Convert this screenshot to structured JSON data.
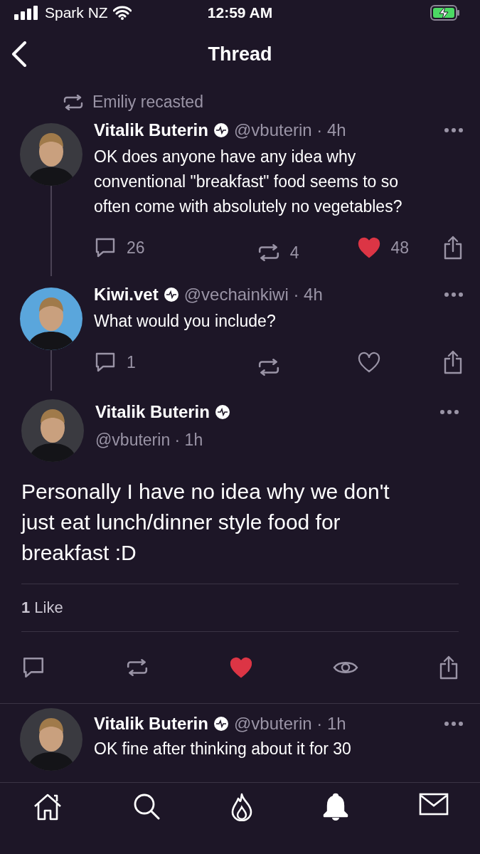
{
  "status_bar": {
    "carrier": "Spark NZ",
    "time": "12:59 AM",
    "charging": true
  },
  "header": {
    "title": "Thread"
  },
  "recast": {
    "text": "Emiliy recasted"
  },
  "thread": [
    {
      "name": "Vitalik Buterin",
      "meta": "@vbuterin · 4h",
      "avatar": {
        "kind": "picture",
        "color": "#3a3a40"
      },
      "text": "OK does anyone have any idea why conventional \"breakfast\" food seems to so often come with absolutely no vegetables?",
      "actions": [
        {
          "kind": "reply",
          "count": "26",
          "selected": false
        },
        {
          "kind": "recast",
          "count": "4",
          "selected": false
        },
        {
          "kind": "like",
          "count": "48",
          "selected": true
        },
        {
          "kind": "share",
          "selected": false
        }
      ]
    },
    {
      "name": "Kiwi.vet",
      "meta": "@vechainkiwi · 4h",
      "avatar": {
        "kind": "picture",
        "color": "#5aa6dc"
      },
      "text": "What would you include?",
      "actions": [
        {
          "kind": "reply",
          "count": "1",
          "selected": false
        },
        {
          "kind": "recast",
          "selected": false
        },
        {
          "kind": "like",
          "selected": false
        },
        {
          "kind": "share",
          "selected": false
        }
      ]
    }
  ],
  "focused": {
    "name": "Vitalik Buterin",
    "meta": "@vbuterin · 1h",
    "avatar": {
      "kind": "picture",
      "color": "#3a3a40"
    },
    "text": "Personally I have no idea why we don't just eat lunch/dinner style food for breakfast :D",
    "likes": "**1** Like",
    "actions": [
      {
        "kind": "reply",
        "selected": false
      },
      {
        "kind": "recast",
        "selected": false
      },
      {
        "kind": "like",
        "selected": true
      },
      {
        "kind": "views",
        "selected": false
      },
      {
        "kind": "share",
        "selected": false
      }
    ]
  },
  "next": {
    "name": "Vitalik Buterin",
    "meta": "@vbuterin · 1h",
    "avatar": {
      "kind": "picture",
      "color": "#3a3a40"
    },
    "text": "OK fine after thinking about it for 30"
  },
  "tab_bar": [
    {
      "kind": "home",
      "selected": false
    },
    {
      "kind": "search",
      "selected": false
    },
    {
      "kind": "trending",
      "selected": false
    },
    {
      "kind": "notifications",
      "selected": true
    },
    {
      "kind": "messages",
      "selected": false
    }
  ]
}
